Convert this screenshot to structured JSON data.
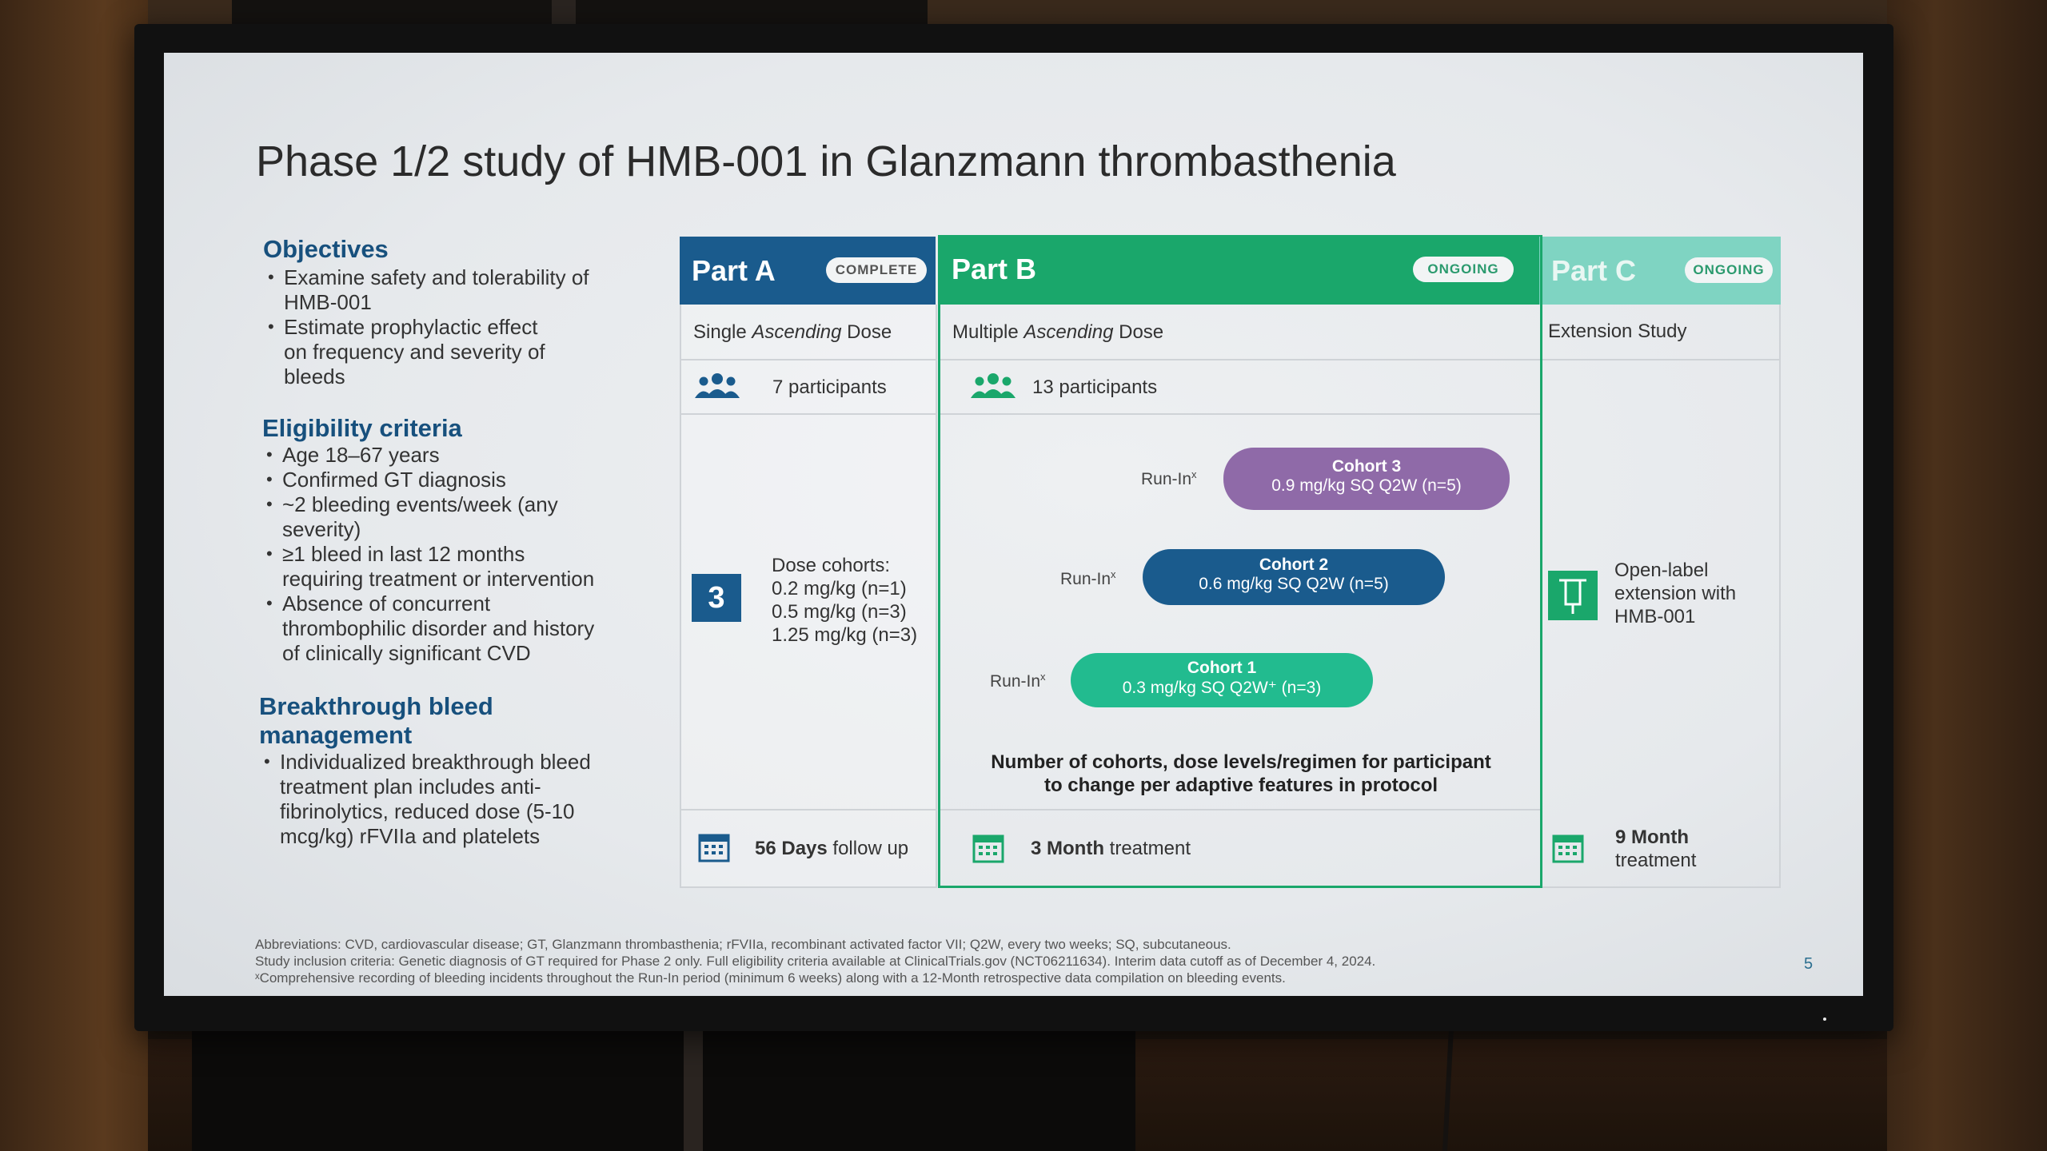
{
  "slide": {
    "title": "Phase 1/2 study of HMB-001 in Glanzmann thrombasthenia",
    "page_number": "5",
    "left": {
      "objectives_heading": "Objectives",
      "objectives": [
        [
          "Examine safety and tolerability of",
          "HMB-001"
        ],
        [
          "Estimate prophylactic effect",
          "on frequency and severity of",
          "bleeds"
        ]
      ],
      "eligibility_heading": "Eligibility criteria",
      "eligibility": [
        [
          "Age 18–67 years"
        ],
        [
          "Confirmed GT diagnosis"
        ],
        [
          "~2 bleeding events/week (any",
          "severity)"
        ],
        [
          "≥1 bleed in last 12 months",
          "requiring treatment or intervention"
        ],
        [
          "Absence of concurrent",
          "thrombophilic disorder and history",
          "of clinically significant CVD"
        ]
      ],
      "breakthrough_heading_1": "Breakthrough bleed",
      "breakthrough_heading_2": "management",
      "breakthrough": [
        [
          "Individualized breakthrough bleed",
          "treatment plan includes anti-",
          "fibrinolytics, reduced dose (5-10",
          "mcg/kg) rFVIIa and platelets"
        ]
      ]
    },
    "part_a": {
      "title": "Part A",
      "status": "COMPLETE",
      "design_prefix": "Single ",
      "design_italic": "Ascending",
      "design_suffix": " Dose",
      "participants": "7 participants",
      "cohort_count": "3",
      "dose_lines": [
        "Dose cohorts:",
        "0.2 mg/kg (n=1)",
        "0.5 mg/kg (n=3)",
        "1.25 mg/kg (n=3)"
      ],
      "followup_bold": "56 Days",
      "followup_rest": " follow up"
    },
    "part_b": {
      "title": "Part B",
      "status": "ONGOING",
      "design_prefix": "Multiple ",
      "design_italic": "Ascending",
      "design_suffix": " Dose",
      "participants": "13 participants",
      "runin_label": "Run-In",
      "runin_sup": "x",
      "cohorts": [
        {
          "title": "Cohort 3",
          "dose": "0.9 mg/kg SQ Q2W (n=5)",
          "color": "#8f6aa8"
        },
        {
          "title": "Cohort 2",
          "dose": "0.6 mg/kg SQ Q2W (n=5)",
          "color": "#1a5b8d"
        },
        {
          "title": "Cohort 1",
          "dose": "0.3 mg/kg SQ Q2W⁺ (n=3)",
          "color": "#22bb8f"
        }
      ],
      "note_1": "Number of cohorts, dose levels/regimen for participant",
      "note_2": "to change per adaptive features in protocol",
      "treatment_bold": "3 Month",
      "treatment_rest": " treatment"
    },
    "part_c": {
      "title": "Part C",
      "status": "ONGOING",
      "design": "Extension Study",
      "extension_lines": [
        "Open-label",
        "extension with",
        "HMB-001"
      ],
      "treatment_bold": "9 Month",
      "treatment_rest": "treatment"
    },
    "footnotes": [
      "Abbreviations: CVD, cardiovascular disease; GT, Glanzmann thrombasthenia; rFVIIa, recombinant activated factor VII; Q2W, every two weeks; SQ, subcutaneous.",
      "Study inclusion criteria: Genetic diagnosis of GT required for Phase 2 only. Full eligibility criteria available at ClinicalTrials.gov (NCT06211634). Interim data cutoff as of December 4, 2024.",
      "ˣComprehensive recording of bleeding incidents throughout the Run-In period (minimum 6 weeks) along with a 12-Month retrospective data compilation on bleeding events."
    ],
    "colors": {
      "part_a": "#1a5b8d",
      "part_b": "#1aa76b",
      "part_c": "#7fd4c2",
      "heading": "#17507d"
    }
  }
}
